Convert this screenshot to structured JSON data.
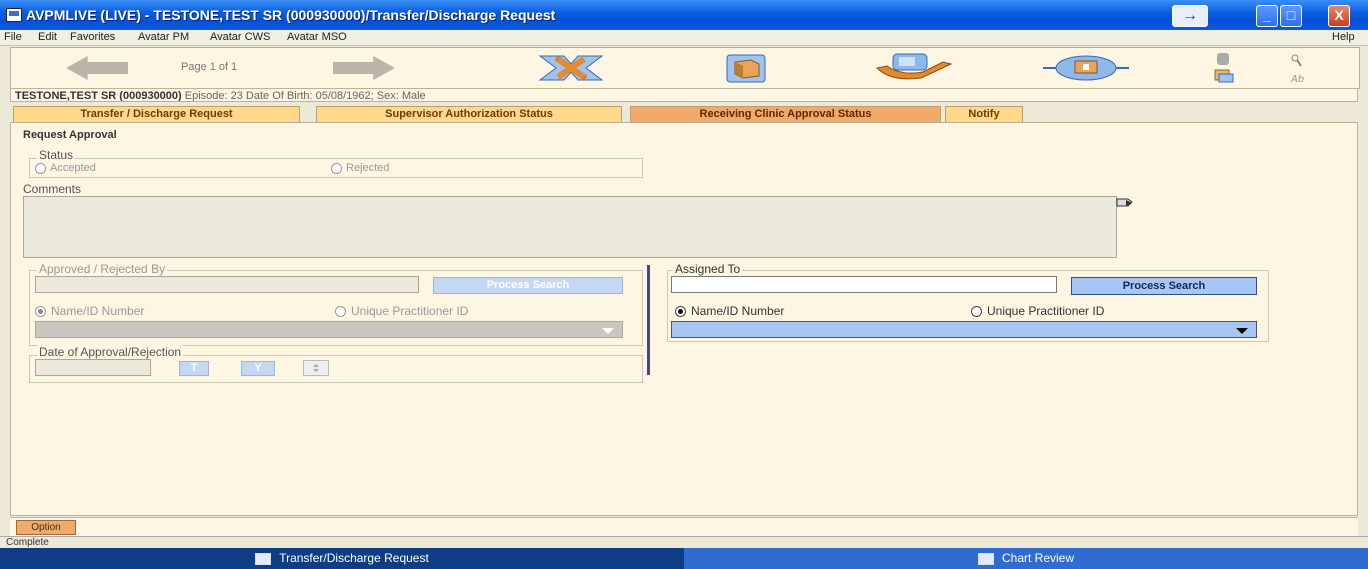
{
  "window": {
    "title": "AVPMLIVE (LIVE) - TESTONE,TEST SR (000930000)/Transfer/Discharge Request",
    "arrow_glyph": "→",
    "min_glyph": "_",
    "max_glyph": "□",
    "close_glyph": "X"
  },
  "menu": {
    "items": [
      "File",
      "Edit",
      "Favorites",
      "Avatar PM",
      "Avatar CWS",
      "Avatar MSO"
    ],
    "help": "Help"
  },
  "toolbar": {
    "page_info": "Page 1 of 1"
  },
  "patient": {
    "name": "TESTONE,TEST SR (000930000)",
    "details": " Episode: 23 Date Of Birth: 05/08/1962; Sex: Male"
  },
  "tabs": [
    {
      "label": "Transfer / Discharge Request",
      "active": false
    },
    {
      "label": "Supervisor Authorization Status",
      "active": false
    },
    {
      "label": "Receiving Clinic Approval Status",
      "active": true
    },
    {
      "label": "Notify",
      "active": false
    }
  ],
  "form": {
    "section_title": "Request Approval",
    "status_label": "Status",
    "status_options": [
      "Accepted",
      "Rejected"
    ],
    "comments_label": "Comments",
    "comments_value": "",
    "approved_by": {
      "label": "Approved / Rejected By",
      "search_button": "Process Search",
      "option_name": "Name/ID Number",
      "option_upi": "Unique Practitioner ID",
      "value": ""
    },
    "date": {
      "label": "Date of Approval/Rejection",
      "value": "",
      "t_button": "T",
      "y_button": "Y"
    },
    "assigned_to": {
      "label": "Assigned To",
      "search_button": "Process Search",
      "option_name": "Name/ID Number",
      "option_upi": "Unique Practitioner ID",
      "value": "",
      "selected": "Name/ID Number"
    }
  },
  "option_button": "Option",
  "status_text": "Complete",
  "taskbar": {
    "items": [
      "Transfer/Discharge Request",
      "Chart Review"
    ]
  },
  "colors": {
    "title_blue": "#0650d6",
    "panel_bg": "#fdf6e3",
    "tab_active": "#f3a968",
    "tab_inactive": "#ffd88a",
    "taskbar_blue": "#0e3d86"
  }
}
